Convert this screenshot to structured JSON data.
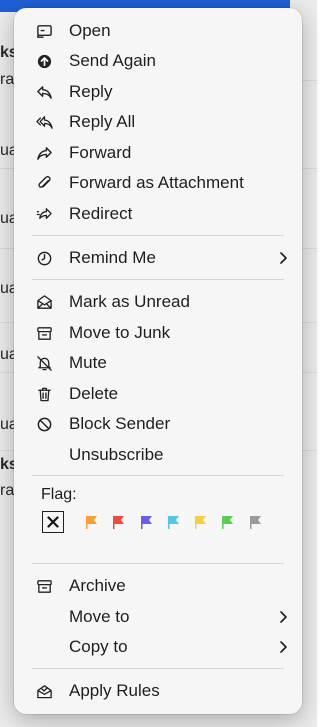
{
  "menu": {
    "items": [
      {
        "label": "Open",
        "icon": "open-icon"
      },
      {
        "label": "Send Again",
        "icon": "send-again-icon"
      },
      {
        "label": "Reply",
        "icon": "reply-icon"
      },
      {
        "label": "Reply All",
        "icon": "reply-all-icon"
      },
      {
        "label": "Forward",
        "icon": "forward-icon"
      },
      {
        "label": "Forward as Attachment",
        "icon": "paperclip-icon"
      },
      {
        "label": "Redirect",
        "icon": "redirect-icon"
      },
      {
        "label": "Remind Me",
        "icon": "clock-icon",
        "submenu": true
      },
      {
        "label": "Mark as Unread",
        "icon": "envelope-open-icon"
      },
      {
        "label": "Move to Junk",
        "icon": "junk-icon"
      },
      {
        "label": "Mute",
        "icon": "bell-slash-icon"
      },
      {
        "label": "Delete",
        "icon": "trash-icon"
      },
      {
        "label": "Block Sender",
        "icon": "block-icon"
      },
      {
        "label": "Unsubscribe",
        "icon": ""
      },
      {
        "label": "Archive",
        "icon": "archive-icon"
      },
      {
        "label": "Move to",
        "icon": "",
        "submenu": true
      },
      {
        "label": "Copy to",
        "icon": "",
        "submenu": true
      },
      {
        "label": "Apply Rules",
        "icon": "apply-rules-icon"
      }
    ],
    "flag_section": {
      "label": "Flag:",
      "flags": [
        {
          "name": "none",
          "color": "#ffffff"
        },
        {
          "name": "orange",
          "color": "#f7a03a"
        },
        {
          "name": "red",
          "color": "#ef4b3f"
        },
        {
          "name": "purple",
          "color": "#6a5ce8"
        },
        {
          "name": "cyan",
          "color": "#55c6e0"
        },
        {
          "name": "yellow",
          "color": "#f5cf3c"
        },
        {
          "name": "green",
          "color": "#5fcb57"
        },
        {
          "name": "gray",
          "color": "#9a9a9a"
        }
      ]
    }
  },
  "background": {
    "fragments": [
      "ks",
      "ra",
      "ua",
      "ua",
      "ua",
      "ua",
      "ua",
      "ks",
      "ra"
    ]
  }
}
